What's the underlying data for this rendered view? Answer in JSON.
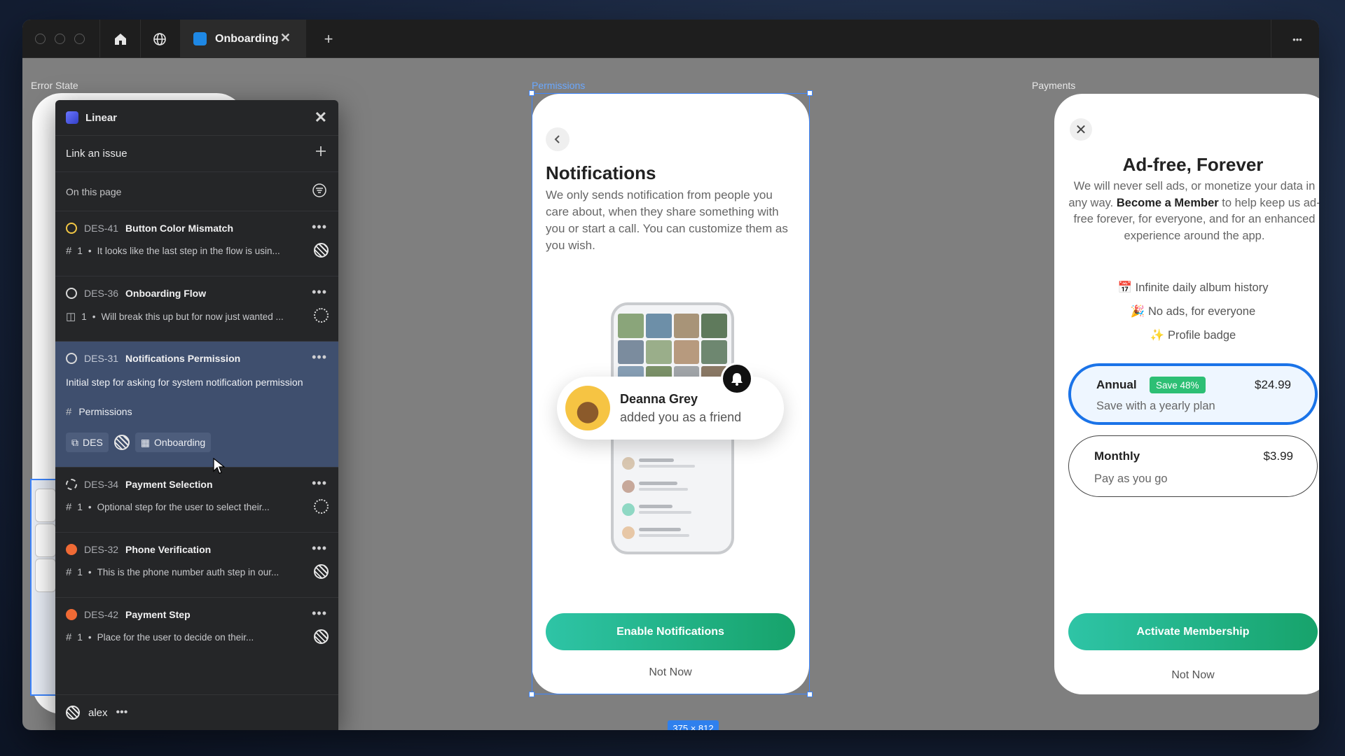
{
  "window": {
    "tab_title": "Onboarding",
    "tab_close": "✕",
    "new_tab": "+",
    "more": "•••"
  },
  "canvas": {
    "frames": {
      "error_state": "Error State",
      "permissions": "Permissions",
      "payments": "Payments"
    },
    "size_tag": "375 × 812"
  },
  "linear": {
    "title": "Linear",
    "link_issue": "Link an issue",
    "on_this_page": "On this page",
    "issues": [
      {
        "id": "DES-41",
        "title": "Button Color Mismatch",
        "count": "1",
        "desc": "It looks like the last step in the flow is usin...",
        "status": "yellow"
      },
      {
        "id": "DES-36",
        "title": "Onboarding Flow",
        "count": "1",
        "desc": "Will break this up but for now just wanted ...",
        "status": "todo"
      },
      {
        "id": "DES-31",
        "title": "Notifications Permission",
        "description": "Initial step for asking for system notification permission",
        "project": "Permissions",
        "chips": {
          "team": "DES",
          "project": "Onboarding"
        },
        "status": "todo"
      },
      {
        "id": "DES-34",
        "title": "Payment Selection",
        "count": "1",
        "desc": "Optional step for the user to select their...",
        "status": "backlog"
      },
      {
        "id": "DES-32",
        "title": "Phone Verification",
        "count": "1",
        "desc": "This is the phone number auth step in our...",
        "status": "urgent"
      },
      {
        "id": "DES-42",
        "title": "Payment Step",
        "count": "1",
        "desc": "Place for the user to decide on their...",
        "status": "urgent"
      }
    ],
    "user": "alex"
  },
  "permissions": {
    "title": "Notifications",
    "body": "We only sends notification from people you care about, when they share something with you or start a call. You can customize them as you wish.",
    "notification": {
      "name": "Deanna Grey",
      "text": "added you as a friend"
    },
    "cta": "Enable Notifications",
    "secondary": "Not Now"
  },
  "payments": {
    "title": "Ad-free, Forever",
    "body_before": "We will never sell ads, or monetize your data in any way. ",
    "body_bold": "Become a Member",
    "body_after": " to help keep us ad-free forever, for everyone, and for an enhanced experience around the app.",
    "features": [
      "📅 Infinite daily album history",
      "🎉 No ads, for everyone",
      "✨ Profile badge"
    ],
    "plans": [
      {
        "name": "Annual",
        "badge": "Save 48%",
        "price": "$24.99",
        "sub": "Save with a yearly plan"
      },
      {
        "name": "Monthly",
        "price": "$3.99",
        "sub": "Pay as you go"
      }
    ],
    "cta": "Activate Membership",
    "secondary": "Not Now"
  },
  "colors": {
    "accent_blue": "#3d86ff",
    "cta_green": "#17a36b",
    "linear_bg": "#252628",
    "active_issue_bg": "#3f4f6e"
  }
}
